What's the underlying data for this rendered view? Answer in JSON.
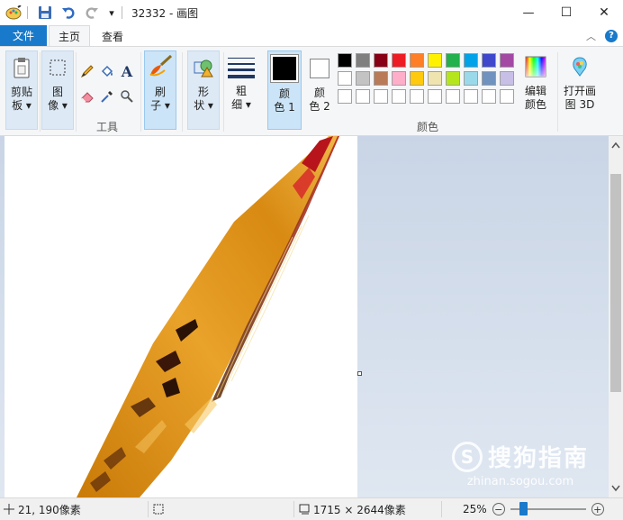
{
  "window": {
    "title": "32332 - 画图",
    "controls": {
      "minimize": "—",
      "maximize": "☐",
      "close": "✕"
    }
  },
  "quick_access": {
    "dropdown": "▾"
  },
  "tabs": {
    "file": "文件",
    "home": "主页",
    "view": "查看",
    "collapse": "︿",
    "help": "?"
  },
  "ribbon": {
    "clipboard": {
      "label_line1": "剪贴",
      "label_line2": "板 ▾"
    },
    "image": {
      "label_line1": "图",
      "label_line2": "像 ▾"
    },
    "tools": {
      "group_label": "工具",
      "text_tool": "A"
    },
    "brushes": {
      "label_line1": "刷",
      "label_line2": "子 ▾"
    },
    "shapes": {
      "label_line1": "形",
      "label_line2": "状 ▾"
    },
    "size": {
      "label_line1": "粗",
      "label_line2": "细 ▾"
    },
    "color1": {
      "label_line1": "颜",
      "label_line2": "色 1",
      "color": "#000000"
    },
    "color2": {
      "label_line1": "颜",
      "label_line2": "色 2",
      "color": "#ffffff"
    },
    "colors": {
      "group_label": "颜色",
      "row1": [
        "#000000",
        "#7f7f7f",
        "#880015",
        "#ed1c24",
        "#ff7f27",
        "#fff200",
        "#22b14c",
        "#00a2e8",
        "#3f48cc",
        "#a349a4"
      ],
      "row2": [
        "#ffffff",
        "#c3c3c3",
        "#b97a57",
        "#ffaec9",
        "#ffc90e",
        "#efe4b0",
        "#b5e61d",
        "#99d9ea",
        "#7092be",
        "#c8bfe7"
      ],
      "row3": [
        "#ffffff",
        "#ffffff",
        "#ffffff",
        "#ffffff",
        "#ffffff",
        "#ffffff",
        "#ffffff",
        "#ffffff",
        "#ffffff",
        "#ffffff"
      ]
    },
    "edit_colors": {
      "label_line1": "编辑",
      "label_line2": "颜色"
    },
    "paint3d": {
      "label_line1": "打开画",
      "label_line2": "图 3D"
    }
  },
  "statusbar": {
    "cursor_pos": "21, 190像素",
    "image_size": "1715 × 2644像素",
    "zoom": "25%",
    "zoom_level": 0.25,
    "zoom_minus": "−",
    "zoom_plus": "+"
  },
  "watermark": {
    "logo": "S",
    "text": "搜狗指南",
    "url": "zhinan.sogou.com"
  }
}
